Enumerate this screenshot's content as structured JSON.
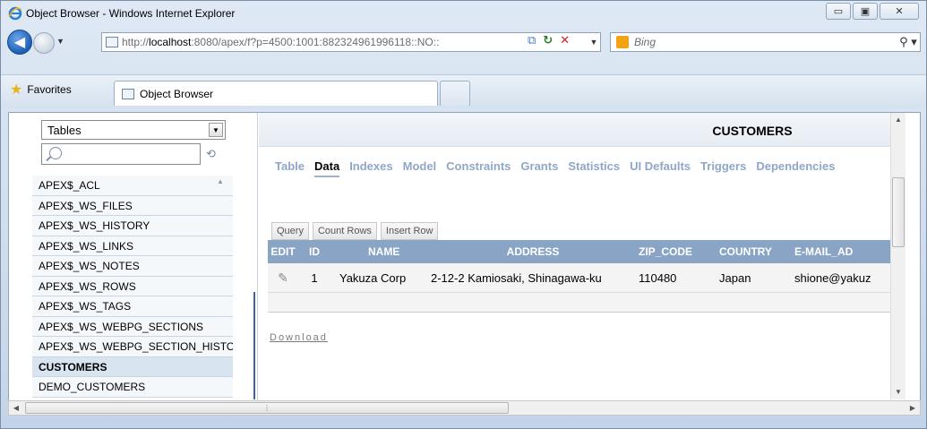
{
  "window": {
    "title": "Object Browser - Windows Internet Explorer",
    "controls": {
      "minimize": "▭",
      "maximize": "▣",
      "close": "✕"
    }
  },
  "toolbar": {
    "address_prefix": "http://",
    "address_host": "localhost",
    "address_rest": ":8080/apex/f?p=4500:1001:882324961996118::NO::",
    "search_placeholder": "Bing",
    "search_icon": "magnifier-icon",
    "refresh_icon": "refresh-icon",
    "stop_icon": "stop-icon"
  },
  "favorites": {
    "label": "Favorites",
    "tab_label": "Object Browser"
  },
  "left_panel": {
    "type_select": "Tables",
    "search_value": "",
    "items": [
      {
        "label": "APEX$_ACL",
        "selected": false
      },
      {
        "label": "APEX$_WS_FILES",
        "selected": false
      },
      {
        "label": "APEX$_WS_HISTORY",
        "selected": false
      },
      {
        "label": "APEX$_WS_LINKS",
        "selected": false
      },
      {
        "label": "APEX$_WS_NOTES",
        "selected": false
      },
      {
        "label": "APEX$_WS_ROWS",
        "selected": false
      },
      {
        "label": "APEX$_WS_TAGS",
        "selected": false
      },
      {
        "label": "APEX$_WS_WEBPG_SECTIONS",
        "selected": false
      },
      {
        "label": "APEX$_WS_WEBPG_SECTION_HISTORY",
        "selected": false
      },
      {
        "label": "CUSTOMERS",
        "selected": true
      },
      {
        "label": "DEMO_CUSTOMERS",
        "selected": false
      }
    ]
  },
  "object": {
    "title": "CUSTOMERS",
    "tabs": [
      "Table",
      "Data",
      "Indexes",
      "Model",
      "Constraints",
      "Grants",
      "Statistics",
      "UI Defaults",
      "Triggers",
      "Dependencies"
    ],
    "active_tab": "Data",
    "actions": [
      "Query",
      "Count Rows",
      "Insert Row"
    ],
    "columns": [
      "EDIT",
      "ID",
      "NAME",
      "ADDRESS",
      "ZIP_CODE",
      "COUNTRY",
      "E-MAIL_AD"
    ],
    "rows": [
      {
        "id": "1",
        "name": "Yakuza Corp",
        "address": "2-12-2 Kamiosaki, Shinagawa-ku",
        "zip_code": "110480",
        "country": "Japan",
        "email": "shione@yakuz"
      }
    ],
    "download_label": "Download"
  }
}
